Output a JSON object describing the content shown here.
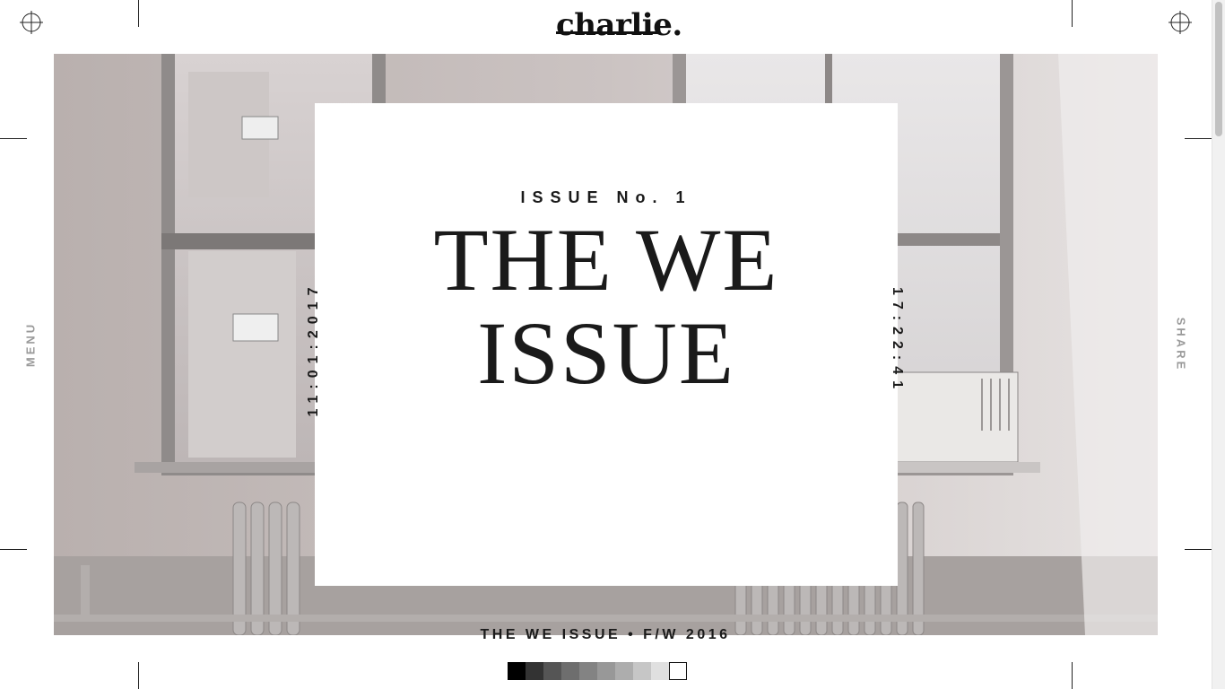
{
  "brand": {
    "logo": "charlie."
  },
  "nav": {
    "menu_label": "MENU",
    "share_label": "SHARE"
  },
  "hero": {
    "issue_number": "ISSUE No. 1",
    "headline_line1": "THE WE",
    "headline_line2": "ISSUE",
    "date": "11:01:2017",
    "time": "17:22:41"
  },
  "footer": {
    "title": "THE WE ISSUE • F/W 2016",
    "swatches": [
      "#000000",
      "#333333",
      "#555555",
      "#6e6e6e",
      "#838383",
      "#989898",
      "#adadad",
      "#c6c6c6",
      "#e0e0e0",
      "#ffffff"
    ]
  },
  "colors": {
    "text": "#1a1a1a",
    "muted": "#9a9a9a",
    "background": "#ffffff"
  }
}
